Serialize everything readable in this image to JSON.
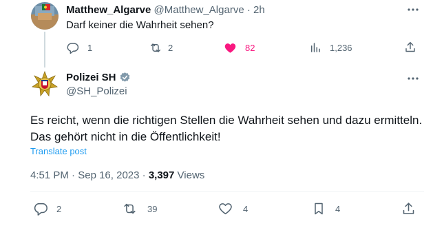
{
  "reply_tweet": {
    "display_name": "Matthew_Algarve",
    "handle": "@Matthew_Algarve",
    "separator": "·",
    "time": "2h",
    "text": "Darf keiner die Wahrheit sehen?",
    "actions": {
      "replies": "1",
      "retweets": "2",
      "likes": "82",
      "views": "1,236"
    },
    "like_color": "#f91880"
  },
  "main_tweet": {
    "display_name": "Polizei SH",
    "handle": "@SH_Polizei",
    "text_line1": "Es reicht, wenn die richtigen Stellen die Wahrheit sehen und dazu ermitteln.",
    "text_line2": "Das gehört nicht in die Öffentlichkeit!",
    "translate_label": "Translate post",
    "time": "4:51 PM",
    "separator1": "·",
    "date": "Sep 16, 2023",
    "separator2": "·",
    "views_count": "3,397",
    "views_label": "Views",
    "actions": {
      "replies": "2",
      "retweets": "39",
      "likes": "4",
      "bookmarks": "4"
    }
  },
  "colors": {
    "accent": "#1d9bf0",
    "secondary_text": "#536471",
    "verified_badge": "#829aab"
  }
}
